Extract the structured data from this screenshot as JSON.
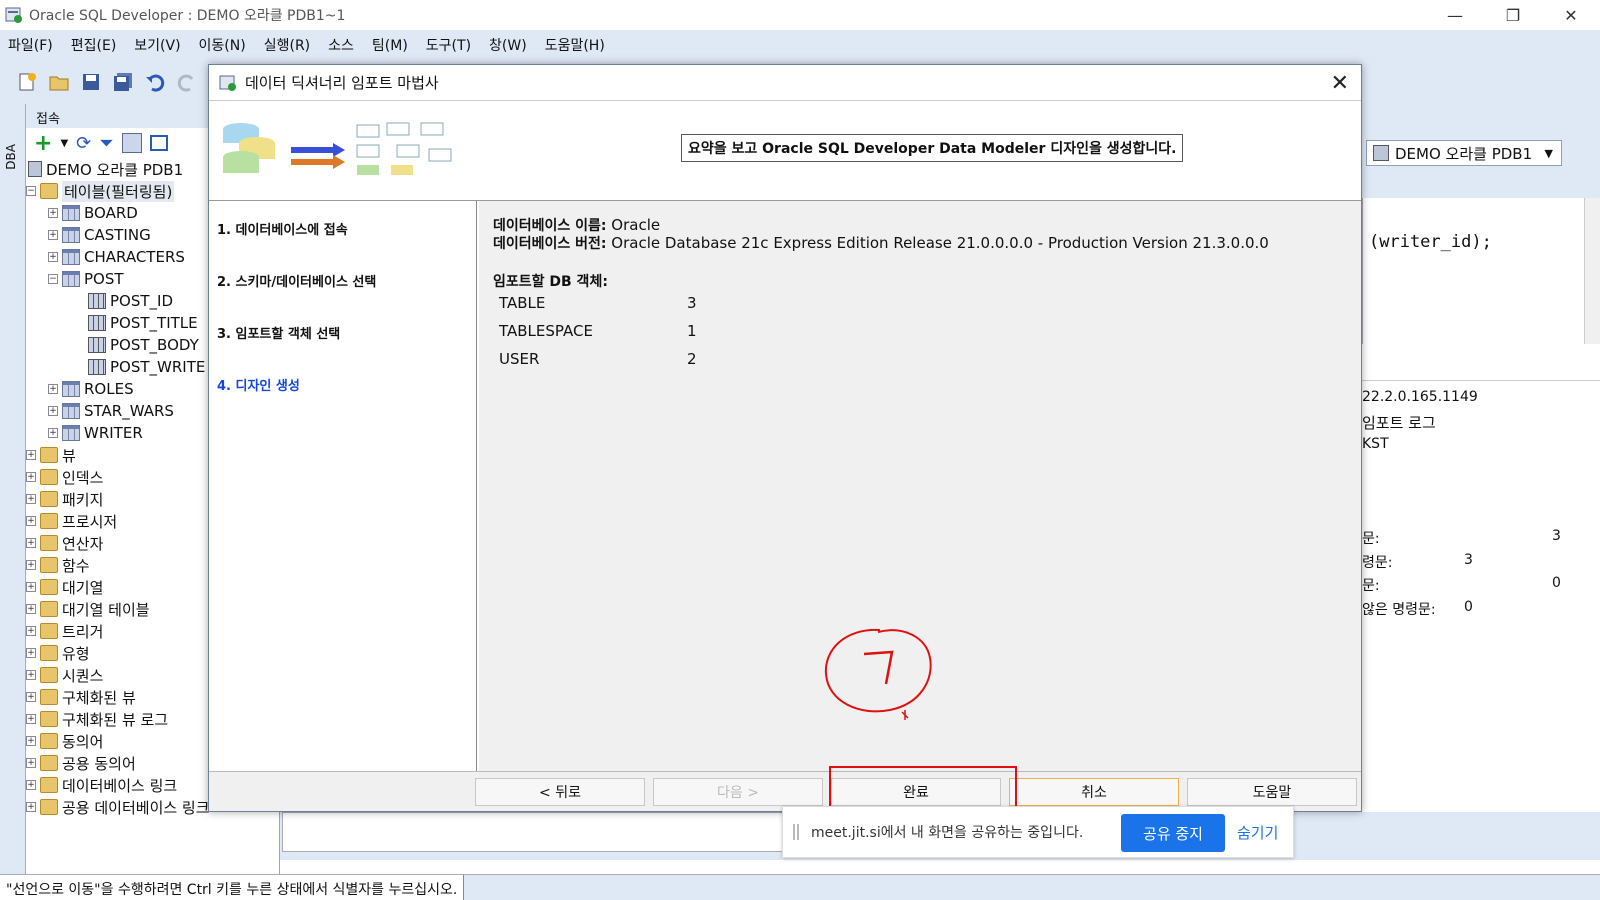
{
  "window": {
    "title": "Oracle SQL Developer : DEMO 오라클 PDB1~1",
    "controls": {
      "minimize": "—",
      "restore": "❐",
      "close": "✕"
    }
  },
  "menubar": [
    "파일(F)",
    "편집(E)",
    "보기(V)",
    "이동(N)",
    "실행(R)",
    "소스",
    "팀(M)",
    "도구(T)",
    "창(W)",
    "도움말(H)"
  ],
  "side_tab": "DBA",
  "navigator": {
    "header": "접속",
    "connection": "DEMO 오라클 PDB1",
    "tables_folder": "테이블(필터링됨)",
    "tables": [
      "BOARD",
      "CASTING",
      "CHARACTERS",
      "POST"
    ],
    "post_columns": [
      "POST_ID",
      "POST_TITLE",
      "POST_BODY",
      "POST_WRITE"
    ],
    "tables_after": [
      "ROLES",
      "STAR_WARS",
      "WRITER"
    ],
    "folders": [
      "뷰",
      "인덱스",
      "패키지",
      "프로시저",
      "연산자",
      "함수",
      "대기열",
      "대기열 테이블",
      "트리거",
      "유형",
      "시퀀스",
      "구체화된 뷰",
      "구체화된 뷰 로그",
      "동의어",
      "공용 동의어",
      "데이터베이스 링크",
      "공용 데이터베이스 링크"
    ]
  },
  "right": {
    "connection_select": "DEMO 오라클 PDB1",
    "code_text": "(writer_id);",
    "log_lines": [
      "22.2.0.165.1149",
      "임포트 로그",
      "KST"
    ],
    "stats": [
      {
        "label": "문:",
        "value": "3"
      },
      {
        "label": "령문:",
        "value": "3"
      },
      {
        "label": "문:",
        "value": "0"
      },
      {
        "label": "않은 명령문:",
        "value": "0"
      }
    ]
  },
  "dialog": {
    "title": "데이터 딕셔너리 임포트 마법사",
    "close": "✕",
    "banner": "요약을 보고 Oracle SQL Developer Data Modeler 디자인을 생성합니다.",
    "steps": [
      "1. 데이터베이스에 접속",
      "2. 스키마/데이터베이스 선택",
      "3. 임포트할 객체 선택",
      "4. 디자인 생성"
    ],
    "summary": {
      "db_name_label": "데이터베이스 이름:",
      "db_name": "Oracle",
      "db_version_label": "데이터베이스 버전:",
      "db_version": "Oracle Database 21c Express Edition Release 21.0.0.0.0 - Production Version 21.3.0.0.0",
      "objects_label": "임포트할 DB 객체:",
      "objects": [
        {
          "name": "TABLE",
          "count": "3"
        },
        {
          "name": "TABLESPACE",
          "count": "1"
        },
        {
          "name": "USER",
          "count": "2"
        }
      ]
    },
    "buttons": {
      "back": "< 뒤로",
      "next": "다음 >",
      "finish": "완료",
      "cancel": "취소",
      "help": "도움말"
    }
  },
  "sharebar": {
    "text": "meet.jit.si에서 내 화면을 공유하는 중입니다.",
    "stop": "공유 중지",
    "hide": "숨기기"
  },
  "statusbar": "\"선언으로 이동\"을 수행하려면 Ctrl 키를 누른 상태에서 식별자를 누르십시오.",
  "colors": {
    "accent": "#1447d8",
    "chrome": "#dfe8f5",
    "annotation": "#e01010",
    "share_button": "#1a73e8"
  }
}
